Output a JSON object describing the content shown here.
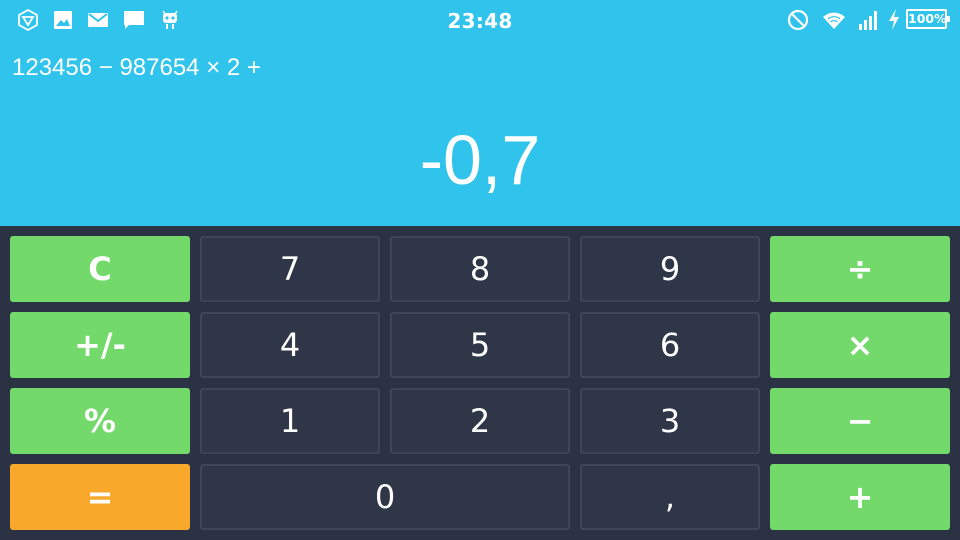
{
  "status_bar": {
    "time": "23:48",
    "battery_text": "100%",
    "left_icons": [
      "ingress-icon",
      "image-icon",
      "mail-icon",
      "chat-icon",
      "android-bug-icon"
    ],
    "right_icons": [
      "do-not-disturb-icon",
      "wifi-icon",
      "signal-icon",
      "charging-bolt-icon",
      "battery-icon"
    ]
  },
  "display": {
    "expression": "123456 − 987654 × 2 +",
    "result": "-0,7"
  },
  "colors": {
    "display_bg": "#30c4ec",
    "keypad_bg": "#2a3243",
    "number_key": "#2e3648",
    "operator_key": "#72d96a",
    "equals_key": "#f8a82b"
  },
  "keys": {
    "clear": "C",
    "seven": "7",
    "eight": "8",
    "nine": "9",
    "divide": "÷",
    "plus_minus": "+/-",
    "four": "4",
    "five": "5",
    "six": "6",
    "multiply": "×",
    "percent": "%",
    "one": "1",
    "two": "2",
    "three": "3",
    "minus": "−",
    "equals": "=",
    "zero": "0",
    "decimal": ",",
    "plus": "+"
  }
}
